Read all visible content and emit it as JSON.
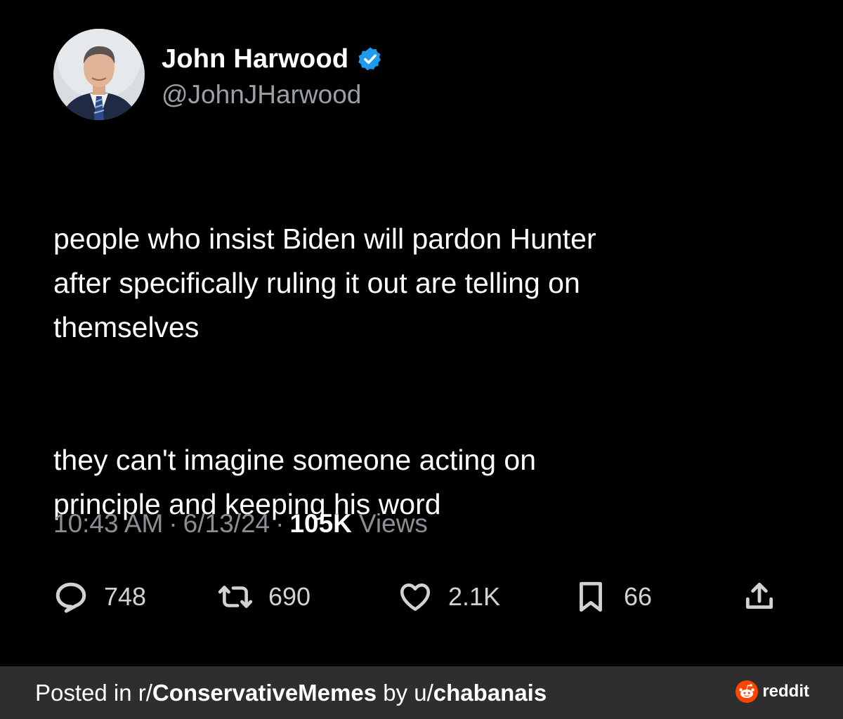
{
  "author": {
    "display_name": "John Harwood",
    "handle": "@JohnJHarwood",
    "verified": true,
    "avatar_icon": "profile-photo"
  },
  "tweet": {
    "paragraphs": [
      "people who insist Biden will pardon Hunter\nafter specifically ruling it out are telling on\nthemselves",
      "they can't imagine someone acting on\nprinciple and keeping his word"
    ],
    "time": "10:43 AM",
    "date": "6/13/24",
    "separator": "·",
    "views_count": "105K",
    "views_label": "Views"
  },
  "actions": {
    "replies": "748",
    "retweets": "690",
    "likes": "2.1K",
    "bookmarks": "66"
  },
  "footer": {
    "prefix": "Posted in r/",
    "subreddit": "ConservativeMemes",
    "middle": " by u/",
    "user": "chabanais",
    "brand": "reddit"
  },
  "colors": {
    "background": "#000000",
    "verified_blue": "#1d9bf0",
    "footer_bg": "#2e2e2e",
    "reddit_orange": "#ff4500"
  }
}
